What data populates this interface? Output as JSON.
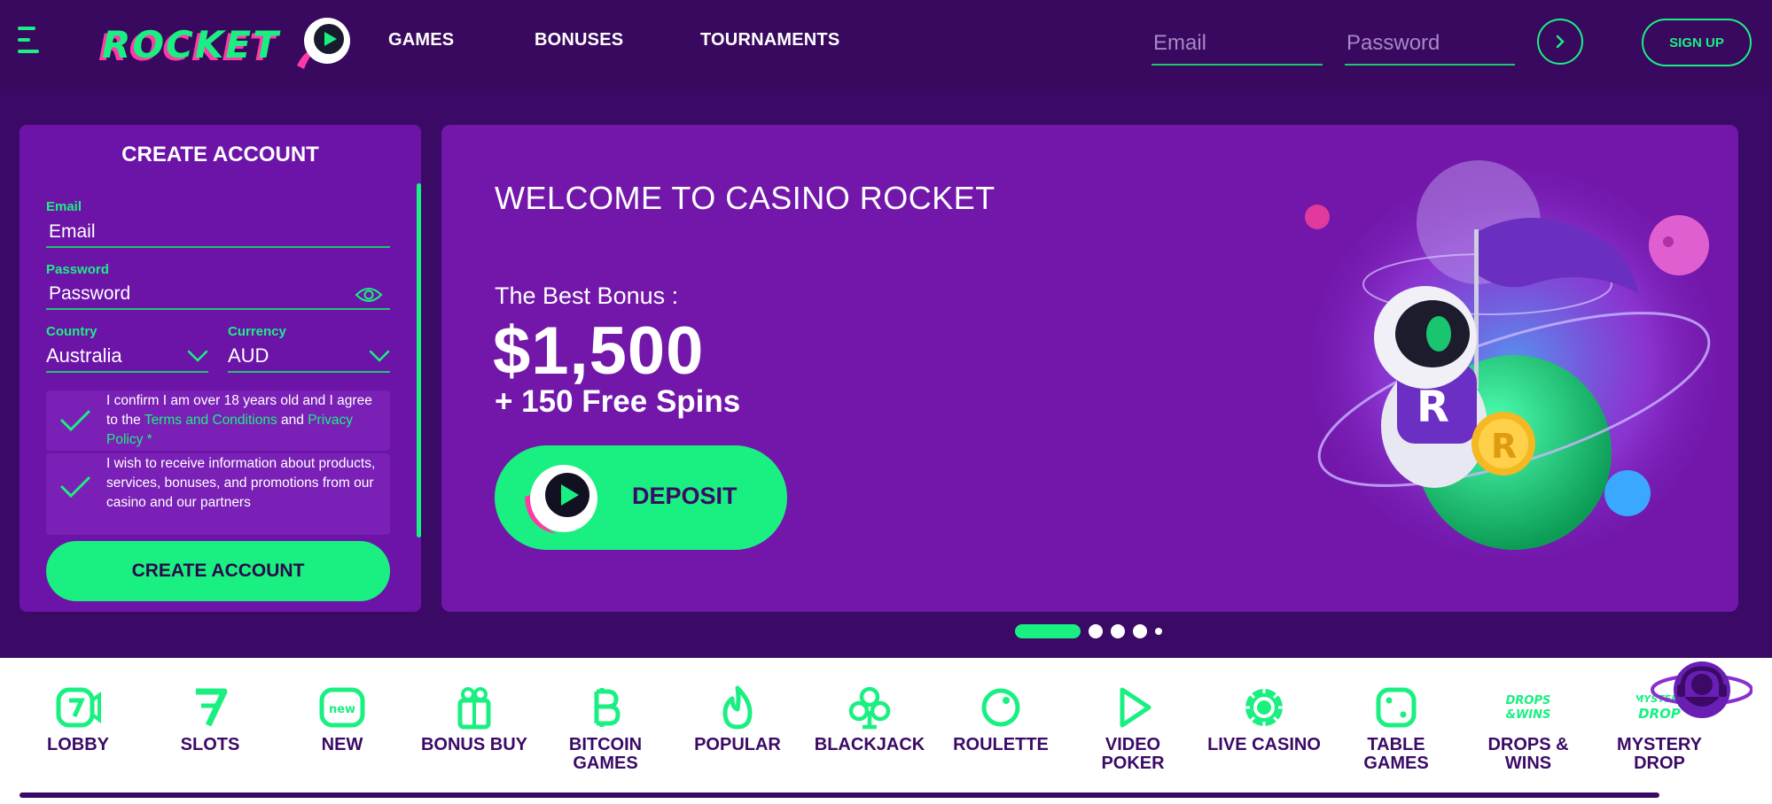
{
  "header": {
    "logo_text": "ROCKET",
    "nav": [
      "GAMES",
      "BONUSES",
      "TOURNAMENTS"
    ],
    "email_placeholder": "Email",
    "password_placeholder": "Password",
    "signup_label": "SIGN UP"
  },
  "create_account": {
    "title": "CREATE ACCOUNT",
    "email_label": "Email",
    "email_placeholder": "Email",
    "password_label": "Password",
    "password_placeholder": "Password",
    "country_label": "Country",
    "country_value": "Australia",
    "currency_label": "Currency",
    "currency_value": "AUD",
    "consent_1_part1": "I confirm I am over 18 years old and I agree to the ",
    "consent_1_terms": "Terms and Conditions",
    "consent_1_and": " and ",
    "consent_1_privacy": "Privacy Policy *",
    "consent_2": "I wish to receive information about products, services, bonuses, and promotions from our casino and our partners",
    "button": "CREATE ACCOUNT"
  },
  "banner": {
    "welcome": "WELCOME TO CASINO ROCKET",
    "best_bonus": "The Best Bonus :",
    "amount": "$1,500",
    "spins": "+ 150 Free Spins",
    "deposit": "DEPOSIT"
  },
  "carousel": {
    "slides": 5,
    "active_index": 0
  },
  "categories": [
    {
      "label": "LOBBY",
      "icon": "lobby-icon"
    },
    {
      "label": "SLOTS",
      "icon": "slots-icon"
    },
    {
      "label": "NEW",
      "icon": "new-icon",
      "icon_text": "new"
    },
    {
      "label": "BONUS BUY",
      "icon": "gift-icon"
    },
    {
      "label": "BITCOIN\nGAMES",
      "icon": "bitcoin-icon"
    },
    {
      "label": "POPULAR",
      "icon": "fire-icon"
    },
    {
      "label": "BLACKJACK",
      "icon": "club-icon"
    },
    {
      "label": "ROULETTE",
      "icon": "roulette-icon"
    },
    {
      "label": "VIDEO\nPOKER",
      "icon": "play-icon"
    },
    {
      "label": "LIVE CASINO",
      "icon": "chip-icon"
    },
    {
      "label": "TABLE\nGAMES",
      "icon": "dice-icon"
    },
    {
      "label": "DROPS &\nWINS",
      "icon": "drops-wins-icon",
      "icon_text": "DROPS & WINS"
    },
    {
      "label": "MYSTERY\nDROP",
      "icon": "mystery-drop-icon",
      "icon_text": "MYSTERY DROP"
    }
  ],
  "colors": {
    "header_bg": "#38095e",
    "hero_bg": "#3b0a66",
    "panel_bg": "#6c14a8",
    "banner_bg": "#7217aa",
    "accent_green": "#19f081",
    "category_text": "#3b0a66"
  }
}
